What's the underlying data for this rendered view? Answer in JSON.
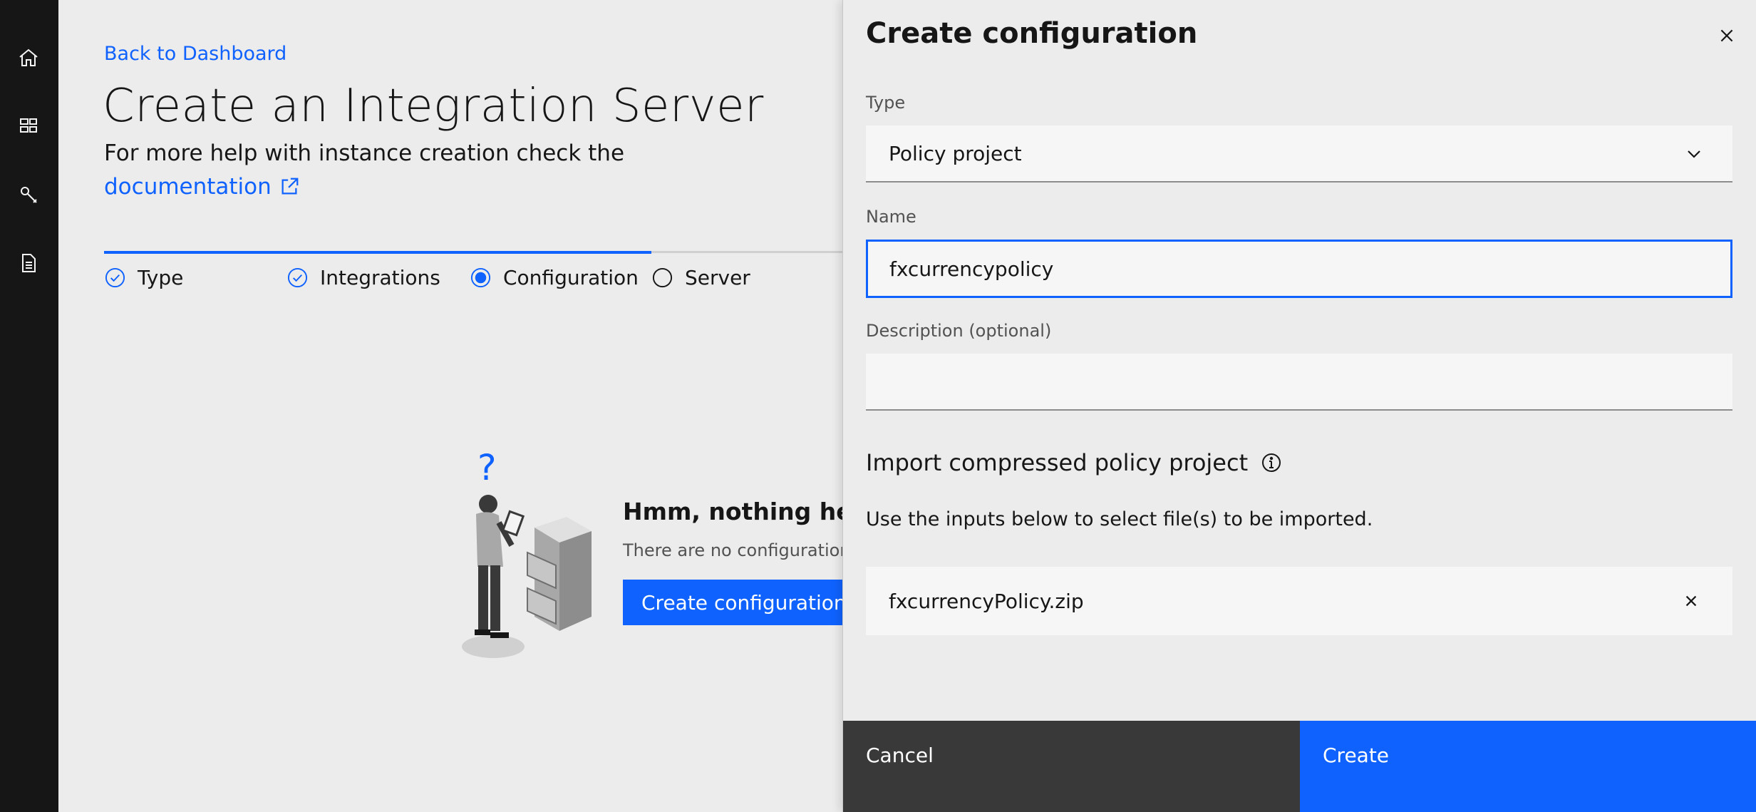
{
  "nav": {
    "items": [
      {
        "name": "home-icon"
      },
      {
        "name": "dashboard-icon"
      },
      {
        "name": "wrench-icon"
      },
      {
        "name": "document-icon"
      }
    ]
  },
  "main": {
    "back_link": "Back to Dashboard",
    "title": "Create an Integration Server",
    "help_text": "For more help with instance creation check the",
    "doc_link": "documentation",
    "steps": [
      {
        "label": "Type",
        "state": "complete"
      },
      {
        "label": "Integrations",
        "state": "complete"
      },
      {
        "label": "Configuration",
        "state": "current"
      },
      {
        "label": "Server",
        "state": "incomplete"
      }
    ],
    "progress_fraction": 0.75,
    "empty_state": {
      "title": "Hmm, nothing here yet",
      "description": "There are no configurations",
      "button": "Create configuration"
    }
  },
  "panel": {
    "title": "Create configuration",
    "type_label": "Type",
    "type_value": "Policy project",
    "name_label": "Name",
    "name_value": "fxcurrencypolicy",
    "description_label": "Description (optional)",
    "description_value": "",
    "import_heading": "Import compressed policy project",
    "import_description": "Use the inputs below to select file(s) to be imported.",
    "file_name": "fxcurrencyPolicy.zip",
    "cancel": "Cancel",
    "create": "Create"
  },
  "colors": {
    "accent": "#0f62fe",
    "rail": "#161616",
    "background": "#ececec",
    "cancel_button": "#393939"
  }
}
